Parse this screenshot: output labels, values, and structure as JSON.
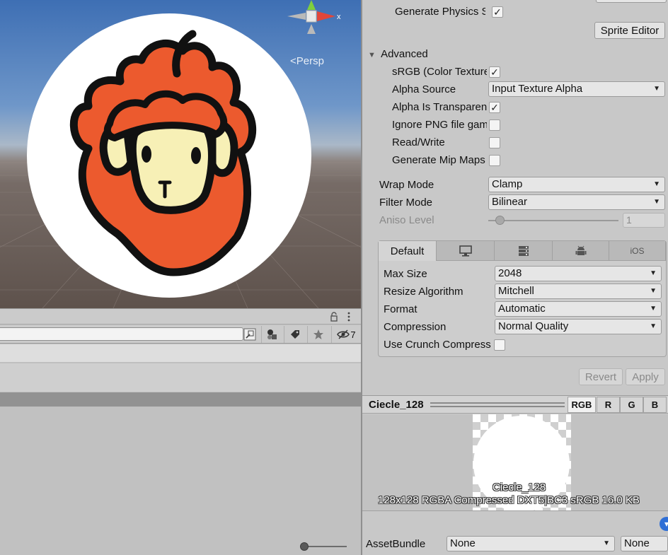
{
  "scene": {
    "persp_label": "Persp",
    "gizmo_axis": "x"
  },
  "project": {
    "search_placeholder": "",
    "hidden_count": "7"
  },
  "inspector": {
    "generate_physics_label": "Generate Physics Shape",
    "generate_physics_checked": true,
    "sprite_editor_label": "Sprite Editor",
    "advanced_label": "Advanced",
    "srgb_label": "sRGB (Color Texture)",
    "srgb_checked": true,
    "alpha_source_label": "Alpha Source",
    "alpha_source_value": "Input Texture Alpha",
    "alpha_transparency_label": "Alpha Is Transparency",
    "alpha_transparency_checked": true,
    "ignore_png_gamma_label": "Ignore PNG file gamma",
    "ignore_png_gamma_checked": false,
    "read_write_label": "Read/Write",
    "read_write_checked": false,
    "generate_mipmap_label": "Generate Mip Maps",
    "generate_mipmap_checked": false,
    "wrap_mode_label": "Wrap Mode",
    "wrap_mode_value": "Clamp",
    "filter_mode_label": "Filter Mode",
    "filter_mode_value": "Bilinear",
    "aniso_level_label": "Aniso Level",
    "aniso_level_value": "1",
    "platform_tabs": [
      "Default",
      "standalone-icon",
      "server-icon",
      "android-icon",
      "iOS"
    ],
    "max_size_label": "Max Size",
    "max_size_value": "2048",
    "resize_algorithm_label": "Resize Algorithm",
    "resize_algorithm_value": "Mitchell",
    "format_label": "Format",
    "format_value": "Automatic",
    "compression_label": "Compression",
    "compression_value": "Normal Quality",
    "crunch_label": "Use Crunch Compression",
    "crunch_checked": false,
    "revert_label": "Revert",
    "apply_label": "Apply",
    "check_glyph": "✓",
    "dropdown_arrow": "▼",
    "foldout_arrow": "▼"
  },
  "preview": {
    "title": "Ciecle_128",
    "channels": [
      "RGB",
      "R",
      "G",
      "B"
    ],
    "active_channel": "RGB",
    "texture_name": "Ciecle_128",
    "texture_info": "128x128  RGBA Compressed DXT5|BC3 sRGB  16.0 KB"
  },
  "assetbundle": {
    "label": "AssetBundle",
    "name_value": "None",
    "variant_value": "None"
  },
  "colors": {
    "hair": "#ec5a2e",
    "face": "#f7f0b6",
    "outline": "#111111"
  }
}
